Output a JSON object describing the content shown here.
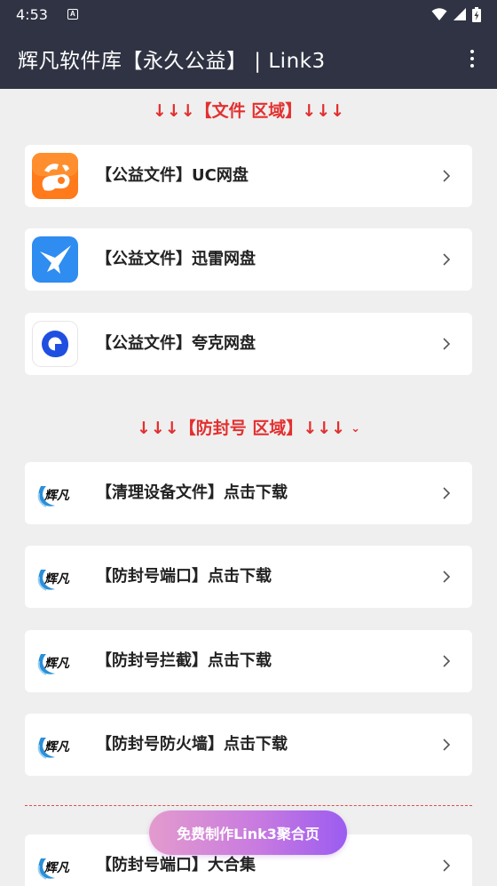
{
  "status_bar": {
    "time": "4:53",
    "notification_glyph": "A"
  },
  "app_bar": {
    "title": "辉凡软件库【永久公益】 | Link3"
  },
  "sections": [
    {
      "header": "↓↓↓【文件 区域】↓↓↓"
    },
    {
      "header": "↓↓↓【防封号 区域】↓↓↓"
    }
  ],
  "file_items": [
    {
      "label": "【公益文件】UC网盘",
      "icon": "uc-drive-icon"
    },
    {
      "label": "【公益文件】迅雷网盘",
      "icon": "xunlei-drive-icon"
    },
    {
      "label": "【公益文件】夸克网盘",
      "icon": "quark-drive-icon"
    }
  ],
  "antiban_items": [
    {
      "label": "【清理设备文件】点击下载",
      "icon": "huifan-logo-icon"
    },
    {
      "label": "【防封号端口】点击下载",
      "icon": "huifan-logo-icon"
    },
    {
      "label": "【防封号拦截】点击下载",
      "icon": "huifan-logo-icon"
    },
    {
      "label": "【防封号防火墙】点击下载",
      "icon": "huifan-logo-icon"
    }
  ],
  "extra_items": [
    {
      "label": "【防封号端口】大合集",
      "icon": "huifan-logo-icon"
    }
  ],
  "logo_text": "辉凡",
  "fab": {
    "label": "免费制作Link3聚合页"
  },
  "colors": {
    "bar": "#2f3343",
    "accent_red": "#e32f2f",
    "background": "#efefef"
  }
}
